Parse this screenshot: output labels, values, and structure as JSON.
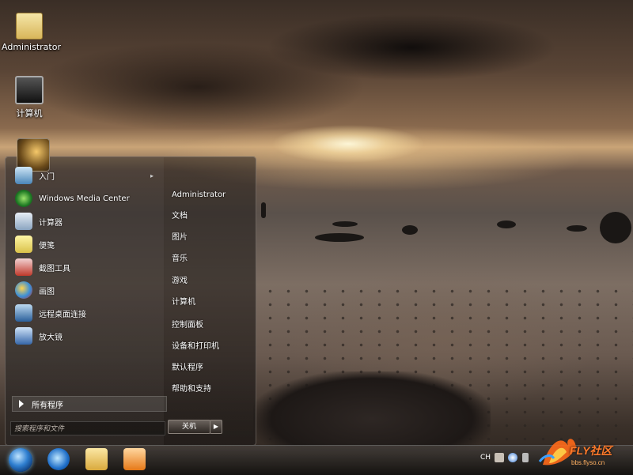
{
  "desktop": {
    "icons": [
      {
        "label": "Administrator",
        "icon": "user-folder-icon"
      },
      {
        "label": "计算机",
        "icon": "computer-icon"
      }
    ]
  },
  "start_menu": {
    "pinned": [
      {
        "label": "入门",
        "icon": "getting-started-icon",
        "has_submenu": true
      },
      {
        "label": "Windows Media Center",
        "icon": "media-center-icon"
      },
      {
        "label": "计算器",
        "icon": "calculator-icon"
      },
      {
        "label": "便笺",
        "icon": "sticky-notes-icon"
      },
      {
        "label": "截图工具",
        "icon": "snipping-tool-icon"
      },
      {
        "label": "画图",
        "icon": "paint-icon"
      },
      {
        "label": "远程桌面连接",
        "icon": "remote-desktop-icon"
      },
      {
        "label": "放大镜",
        "icon": "magnifier-icon"
      }
    ],
    "all_programs": "所有程序",
    "search_placeholder": "搜索程序和文件",
    "right_items": [
      "Administrator",
      "文档",
      "图片",
      "音乐",
      "游戏",
      "计算机",
      "控制面板",
      "设备和打印机",
      "默认程序",
      "帮助和支持"
    ],
    "shutdown_label": "关机",
    "shutdown_arrow": "▶"
  },
  "taskbar": {
    "pinned_apps": [
      {
        "name": "internet-explorer-icon"
      },
      {
        "name": "windows-explorer-icon"
      },
      {
        "name": "media-player-icon"
      }
    ],
    "tray": {
      "language": "CH",
      "watermark_text": "FLY社区",
      "watermark_sub": "bbs.flyso.cn"
    }
  },
  "colors": {
    "start_orb": "#2f7fd0",
    "watermark": "#ff7a2a"
  }
}
